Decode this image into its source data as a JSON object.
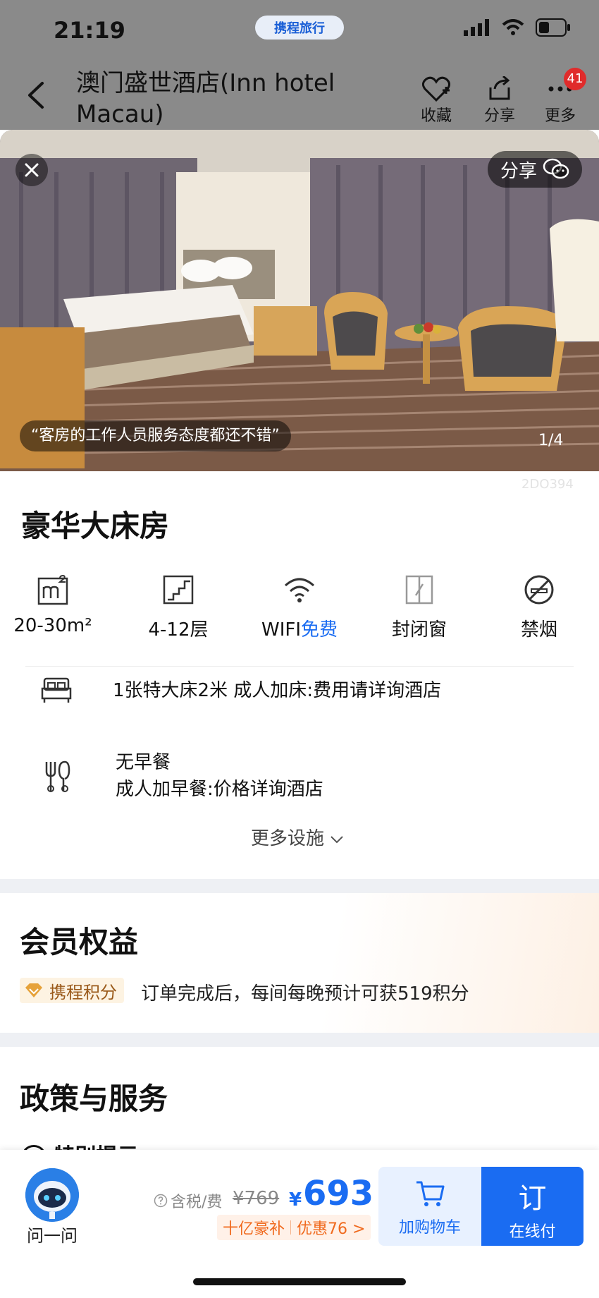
{
  "status": {
    "time": "21:19",
    "app_pill": "携程旅行"
  },
  "header": {
    "title": "澳门盛世酒店(Inn hotel Macau)",
    "favorite_label": "收藏",
    "share_label": "分享",
    "more_label": "更多",
    "more_badge": "41"
  },
  "photo": {
    "share_label": "分享",
    "quote": "“客房的工作人员服务态度都还不错”",
    "counter": "1/4",
    "code": "2DO394"
  },
  "room": {
    "title": "豪华大床房",
    "features": [
      {
        "icon": "area-icon",
        "label": "20-30m²"
      },
      {
        "icon": "floor-icon",
        "label": "4-12层"
      },
      {
        "icon": "wifi-icon",
        "label": "WIFI",
        "extra": "免费"
      },
      {
        "icon": "window-icon",
        "label": "封闭窗"
      },
      {
        "icon": "no-smoking-icon",
        "label": "禁烟"
      }
    ],
    "bed_info": "1张特大床2米  成人加床:费用请详询酒店",
    "meal_line1": "无早餐",
    "meal_line2": "成人加早餐:价格详询酒店",
    "more_facilities": "更多设施"
  },
  "member": {
    "title": "会员权益",
    "points_tag": "携程积分",
    "points_text": "订单完成后，每间每晚预计可获519积分"
  },
  "policy": {
    "title": "政策与服务",
    "peek_text": "特别提示"
  },
  "bottom": {
    "ask_label": "问一问",
    "tax_label": "含税/费",
    "original_price": "¥769",
    "currency": "¥",
    "price": "693",
    "promo1": "十亿豪补",
    "promo2": "优惠76 >",
    "cart_label": "加购物车",
    "book_char": "订",
    "book_label": "在线付"
  },
  "colors": {
    "accent": "#1a6cf2",
    "badge": "#e02b2b",
    "promo": "#f06a1e"
  }
}
